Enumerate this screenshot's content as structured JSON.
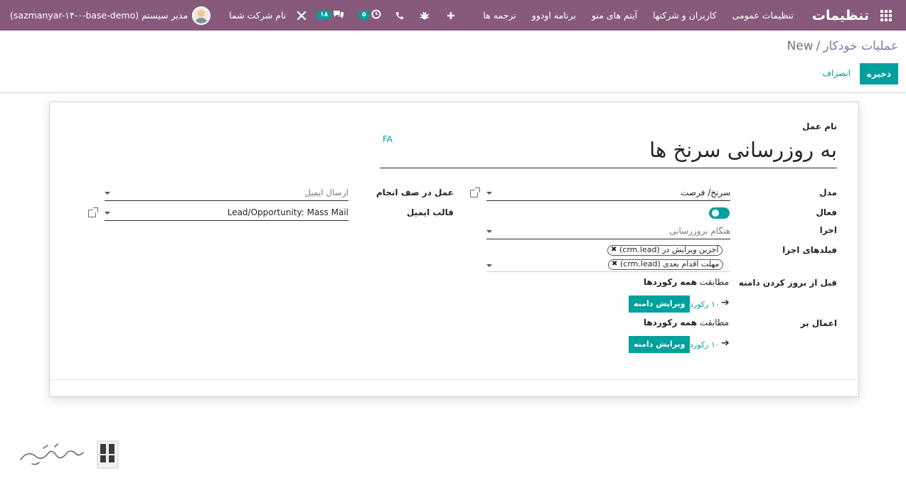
{
  "topbar": {
    "brand": "تنظیمات",
    "menu": [
      "تنظیمات عمومی",
      "کاربران و شرکتها",
      "آیتم های منو",
      "برنامه اودوو",
      "ترجمه ها"
    ],
    "company": "نام شرکت شما",
    "user": "مدیر سیستم (sazmanyar-۱۴-۰-base-demo)",
    "messages_count": "۱۸",
    "activities_count": "۵",
    "icons": [
      "apps-icon",
      "plus-icon",
      "bug-icon",
      "phone-icon",
      "clock-icon",
      "chat-icon",
      "tools-icon"
    ]
  },
  "breadcrumb": {
    "parent": "عملیات خودکار",
    "separator": "/",
    "current": "New"
  },
  "buttons": {
    "save": "ذخیره",
    "discard": "انصراف"
  },
  "form": {
    "name_label": "نام عمل",
    "name_value": "به روزرسانی سرنخ ها",
    "lang": "FA",
    "model_label": "مدل",
    "model_value": "سرنخ/ فرصت",
    "active_label": "فعال",
    "active_value": true,
    "trigger_label": "اجرا",
    "trigger_value": "هنگام بروزرسانی",
    "trigger_fields_label": "فیلدهای اجرا",
    "trigger_fields": [
      "آخرین ویرایش در (crm.lead)",
      "مهلت اقدام بعدی (crm.lead)"
    ],
    "before_domain_label": "قبل از بروز کردن دامنه",
    "match_prefix": "مطابقت",
    "match_all": "همه رکوردها",
    "records_count": "۱۰ رکورد",
    "edit_domain": "ویرایش دامنه",
    "apply_on_label": "اعمال بر",
    "action_label": "عمل در صف انجام",
    "action_value": "ارسال ایمیل",
    "email_template_label": "قالب ایمیل",
    "email_template_value": "Lead/Opportunity: Mass Mail"
  }
}
